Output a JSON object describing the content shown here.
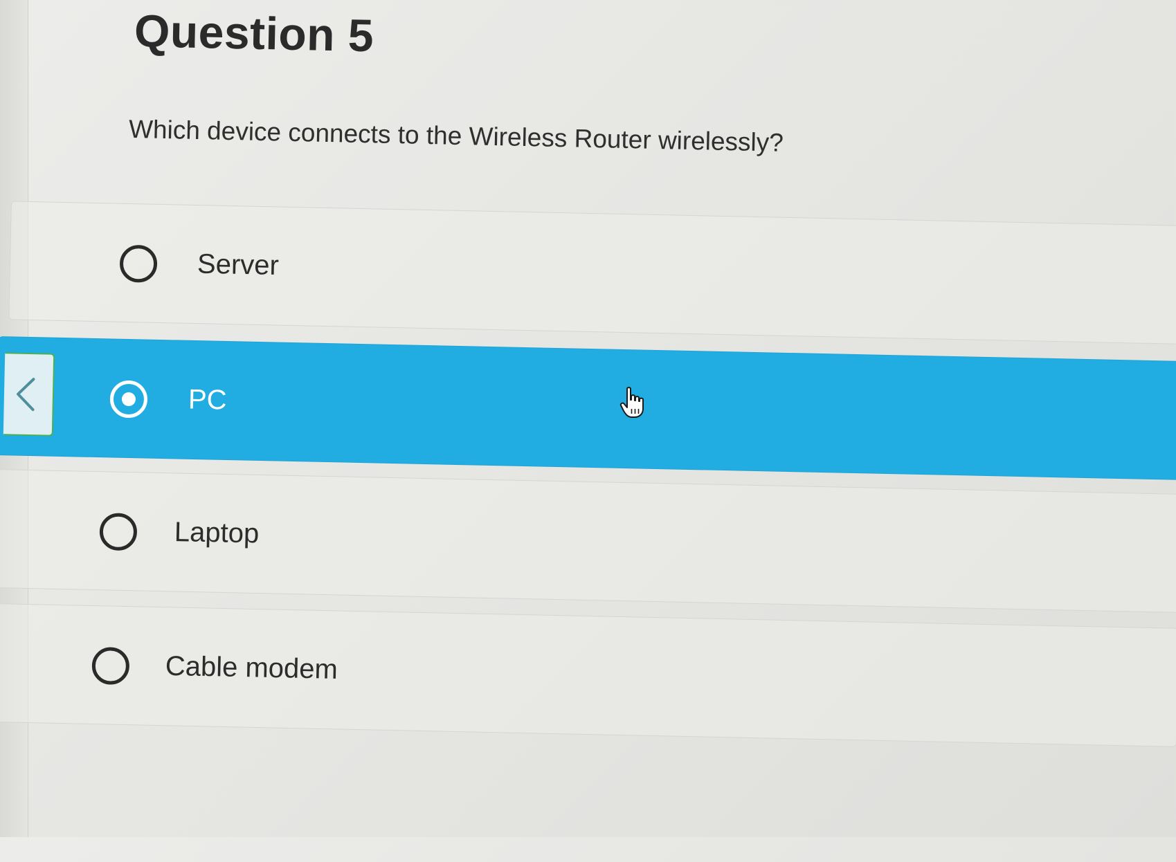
{
  "question": {
    "title": "Question 5",
    "text": "Which device connects to the Wireless Router wirelessly?"
  },
  "options": [
    {
      "label": "Server",
      "selected": false
    },
    {
      "label": "PC",
      "selected": true
    },
    {
      "label": "Laptop",
      "selected": false
    },
    {
      "label": "Cable modem",
      "selected": false
    }
  ],
  "colors": {
    "selected_background": "#22ade2",
    "back_tab_border": "#4caf50"
  },
  "icons": {
    "back": "chevron-left-icon",
    "cursor": "hand-pointer-icon",
    "radio_empty": "radio-empty-icon",
    "radio_selected": "radio-selected-icon"
  }
}
